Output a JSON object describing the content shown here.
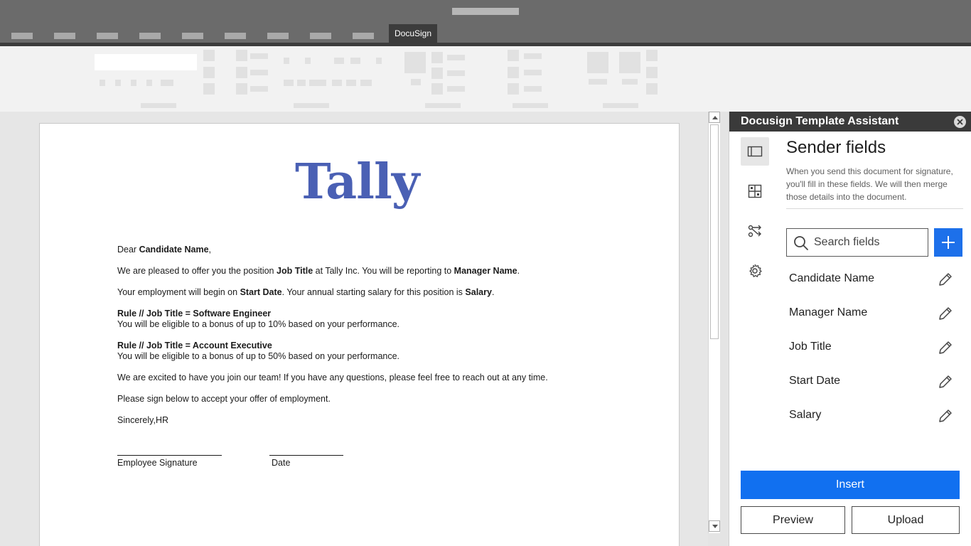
{
  "tabbar": {
    "active_tab": "DocuSign"
  },
  "document": {
    "logo_text": "Tally",
    "lines": {
      "greeting_pre": "Dear ",
      "greeting_field": "Candidate Name",
      "greeting_post": ",",
      "offer_pre": "We are pleased to offer you the position ",
      "offer_field1": "Job Title",
      "offer_mid": " at Tally Inc. You will be reporting to ",
      "offer_field2": "Manager Name",
      "offer_post": ".",
      "employment_pre": "Your employment will begin on ",
      "employment_field1": "Start Date",
      "employment_mid": ". Your annual starting salary for this position is ",
      "employment_field2": "Salary",
      "employment_post": ".",
      "rule1_title": "Rule // Job Title = Software Engineer",
      "rule1_text": "You will be eligible to a bonus of up to 10% based on your performance.",
      "rule2_title": "Rule // Job Title = Account Executive",
      "rule2_text": "You will be eligible to a bonus of up to 50% based on your performance.",
      "excited": "We are excited to have you join our team! If you have any questions, please feel free to reach out at any time.",
      "please_sign": "Please sign below to accept your offer of employment.",
      "sincerely": "Sincerely,HR",
      "employee_signature": "Employee Signature",
      "date": "Date"
    }
  },
  "panel": {
    "header": "Docusign Template Assistant",
    "title": "Sender fields",
    "description": "When you send this document for signature, you'll fill in these fields. We will then merge those details into the document.",
    "search_placeholder": "Search fields",
    "fields": [
      {
        "label": "Candidate Name"
      },
      {
        "label": "Manager Name"
      },
      {
        "label": "Job Title"
      },
      {
        "label": "Start Date"
      },
      {
        "label": "Salary"
      }
    ],
    "insert_label": "Insert",
    "preview_label": "Preview",
    "upload_label": "Upload",
    "accent_color": "#1170f0",
    "rail_icons": [
      "sidebar-panel-icon",
      "layout-grid-icon",
      "workflow-icon",
      "gear-icon"
    ]
  }
}
